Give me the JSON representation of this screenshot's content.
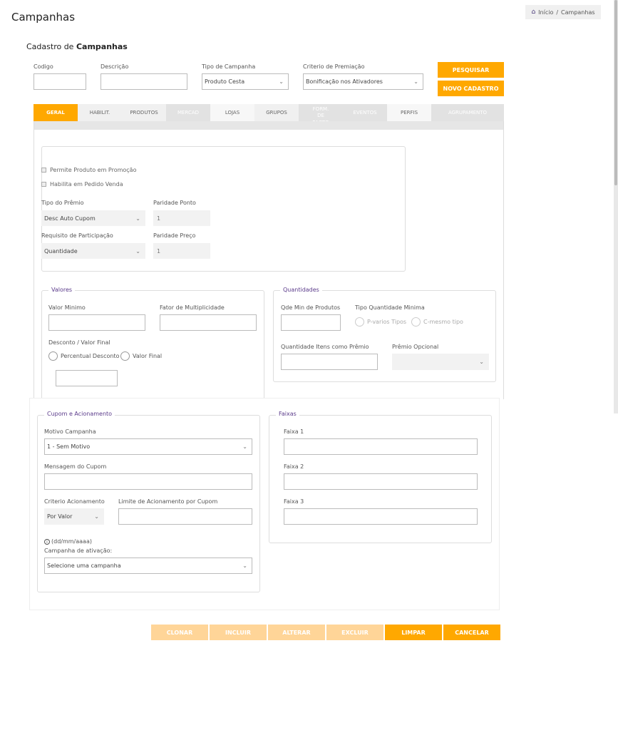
{
  "page": {
    "title": "Campanhas"
  },
  "breadcrumb": {
    "home": "Início",
    "separator": "/",
    "current": "Campanhas"
  },
  "section": {
    "prefix": "Cadastro de",
    "bold": "Campanhas"
  },
  "filters": {
    "codigo_label": "Codigo",
    "descricao_label": "Descrição",
    "tipo_label": "Tipo de Campanha",
    "tipo_value": "Produto Cesta",
    "criterio_label": "Criterio de Premiação",
    "criterio_value": "Bonificação nos Ativadores",
    "pesquisar": "PESQUISAR",
    "novo": "NOVO CADASTRO"
  },
  "tabs": [
    {
      "label": "GERAL"
    },
    {
      "label": "HABILIT."
    },
    {
      "label": "PRODUTOS"
    },
    {
      "label": "MERCAD"
    },
    {
      "label": "LOJAS"
    },
    {
      "label": "GRUPOS"
    },
    {
      "label": "FORM. DE PAGTO"
    },
    {
      "label": "EVENTOS"
    },
    {
      "label": "PERFIS"
    },
    {
      "label": "AGRUPAMENTO"
    }
  ],
  "geral": {
    "chk_promocao": "Permite Produto em Promoção",
    "chk_pedido": "Habilita em Pedido Venda",
    "tipo_premio_label": "Tipo do Prêmio",
    "tipo_premio_value": "Desc Auto Cupom",
    "paridade_ponto_label": "Paridade Ponto",
    "paridade_ponto_value": "1",
    "requisito_label": "Requisito de Participação",
    "requisito_value": "Quantidade",
    "paridade_preco_label": "Paridade Preço",
    "paridade_preco_value": "1"
  },
  "valores": {
    "legend": "Valores",
    "valor_minimo": "Valor Minimo",
    "fator": "Fator de Multiplicidade",
    "desconto_label": "Desconto / Valor Final",
    "radio_percentual": "Percentual Desconto",
    "radio_valor": "Valor Final"
  },
  "quantidades": {
    "legend": "Quantidades",
    "qde_min": "Qde Min de Produtos",
    "tipo_qtd": "Tipo Quantidade Minima",
    "radio_p": "P-varios Tipos",
    "radio_c": "C-mesmo tipo",
    "qtd_itens": "Quantidade Itens como Prêmio",
    "premio_opcional": "Prêmio Opcional"
  },
  "cupom": {
    "legend": "Cupom e Acionamento",
    "motivo_label": "Motivo Campanha",
    "motivo_value": "1 - Sem Motivo",
    "mensagem_label": "Mensagem do Cupom",
    "criterio_label": "Criterio Acionamento",
    "criterio_value": "Por Valor",
    "limite_label": "Limite de Acionamento por Cupom",
    "date_hint": "(dd/mm/aaaa)",
    "campanha_label": "Campanha de ativação:",
    "campanha_value": "Selecione uma campanha"
  },
  "faixas": {
    "legend": "Faixas",
    "faixa1": "Faixa 1",
    "faixa2": "Faixa 2",
    "faixa3": "Faixa 3"
  },
  "actions": {
    "clonar": "CLONAR",
    "incluir": "INCLUIR",
    "alterar": "ALTERAR",
    "excluir": "EXCLUIR",
    "limpar": "LIMPAR",
    "cancelar": "CANCELAR"
  },
  "colors": {
    "accent": "#ffa800",
    "accent_light": "#ffd598",
    "legend": "#5a3a8a"
  }
}
